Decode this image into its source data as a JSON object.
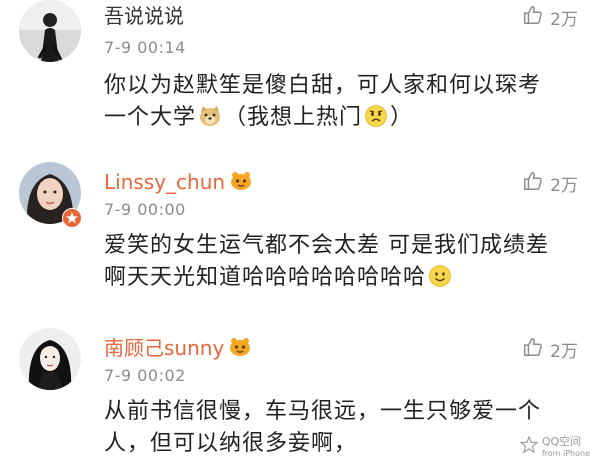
{
  "comments": [
    {
      "username": "吾说说说",
      "time": "7-9 00:14",
      "likes": "2万",
      "text_line1": "你以为赵默笙是傻白甜，可人家和何以琛考",
      "text_line2_part1": "一个大学",
      "text_line2_part2": "（我想上热门",
      "text_line2_part3": "）"
    },
    {
      "username": "Linssy_chun",
      "time": "7-9 00:00",
      "likes": "2万",
      "text_line1": "爱笑的女生运气都不会太差 可是我们成绩差",
      "text_line2": "啊天天光知道哈哈哈哈哈哈哈哈"
    },
    {
      "username": "南顾己sunny",
      "time": "7-9 00:02",
      "likes": "2万",
      "text_line1": "从前书信很慢，车马很远，一生只够爱一个",
      "text_line2": "人，但可以纳很多妾啊，"
    }
  ],
  "watermark": {
    "title": "QQ空间",
    "subtitle": "from iPhone"
  },
  "colors": {
    "username_vip": "#e8663c",
    "username_normal": "#333333",
    "meta": "#8c8c8c"
  }
}
